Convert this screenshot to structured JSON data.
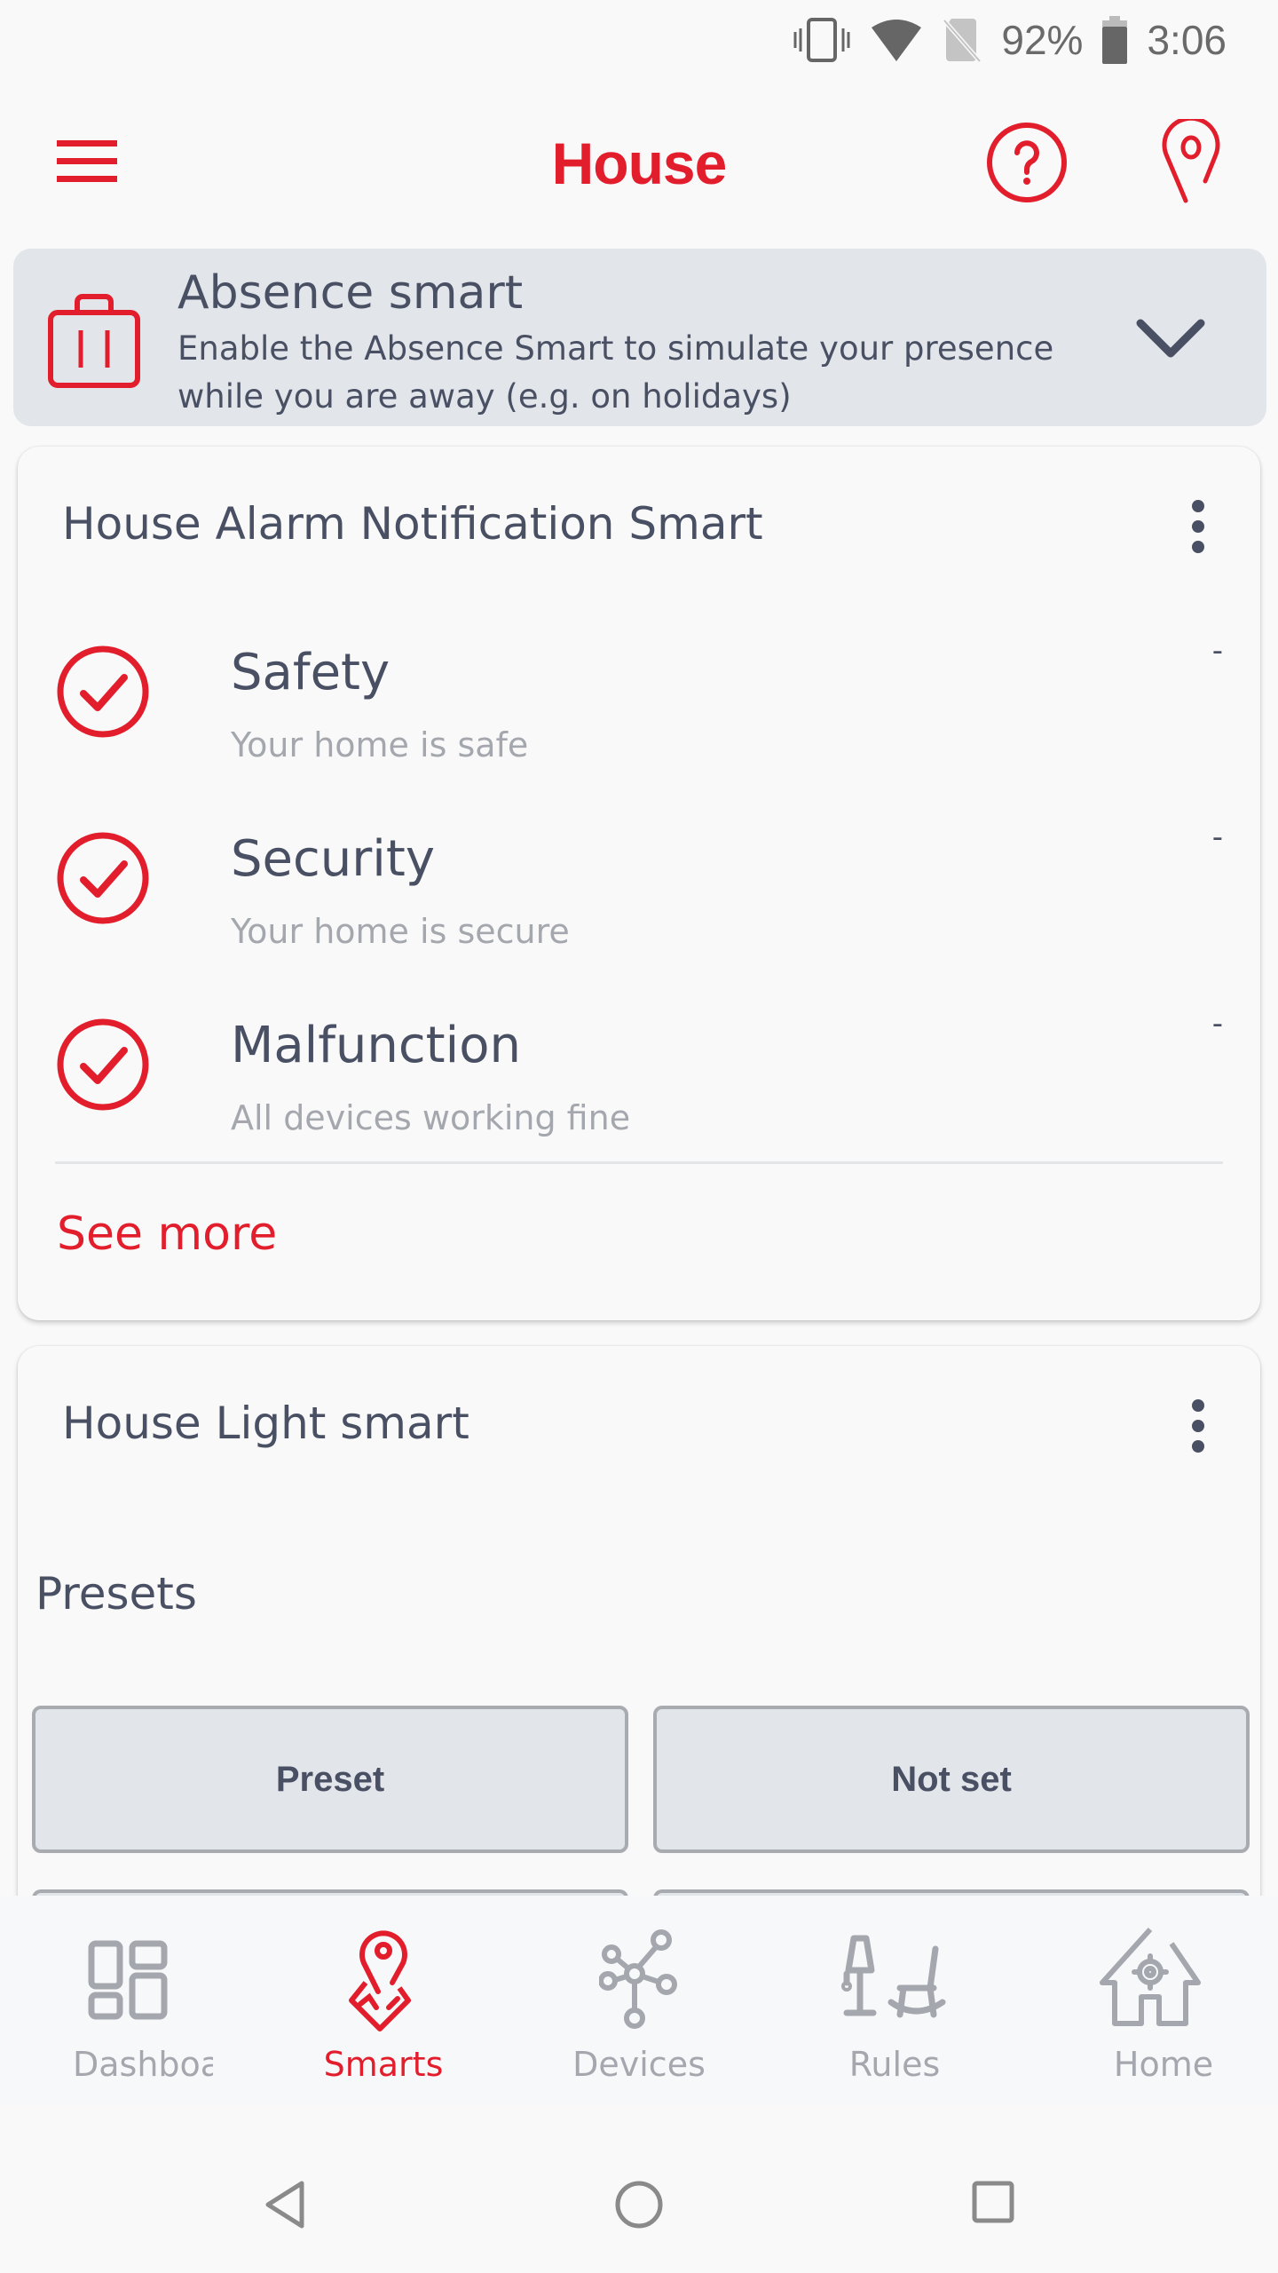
{
  "status_bar": {
    "battery_percent": "92%",
    "time": "3:06",
    "icons": [
      "vibrate-icon",
      "wifi-icon",
      "no-sim-icon",
      "battery-icon"
    ]
  },
  "app_bar": {
    "title": "House",
    "icons": [
      "menu-icon",
      "help-icon",
      "location-pin-icon"
    ]
  },
  "absence_smart": {
    "title": "Absence smart",
    "description": "Enable the Absence Smart to simulate your presence while you are away (e.g. on holidays)",
    "icon": "suitcase-icon",
    "expand_icon": "chevron-down-icon"
  },
  "alarm_card": {
    "title": "House Alarm Notification Smart",
    "items": [
      {
        "name": "Safety",
        "status": "Your home is safe",
        "value": "-",
        "icon": "check-circle-icon"
      },
      {
        "name": "Security",
        "status": "Your home is secure",
        "value": "-",
        "icon": "check-circle-icon"
      },
      {
        "name": "Malfunction",
        "status": "All devices working fine",
        "value": "-",
        "icon": "check-circle-icon"
      }
    ],
    "see_more": "See more"
  },
  "light_card": {
    "title": "House Light smart",
    "presets_label": "Presets",
    "presets": [
      "Preset",
      "Not set"
    ]
  },
  "bottom_nav": {
    "items": [
      {
        "label": "Dashboard",
        "icon": "dashboard-icon",
        "active": false
      },
      {
        "label": "Smarts",
        "icon": "smarts-pin-icon",
        "active": true
      },
      {
        "label": "Devices",
        "icon": "devices-network-icon",
        "active": false
      },
      {
        "label": "Rules",
        "icon": "rules-lamp-chair-icon",
        "active": false
      },
      {
        "label": "Home",
        "icon": "home-gear-icon",
        "active": false
      }
    ]
  },
  "system_nav": [
    "back-icon",
    "home-circle-icon",
    "recents-icon"
  ],
  "colors": {
    "accent": "#e31e2c",
    "text": "#4a5064",
    "muted": "#a4a7ad",
    "banner_bg": "#e2e5e9"
  }
}
